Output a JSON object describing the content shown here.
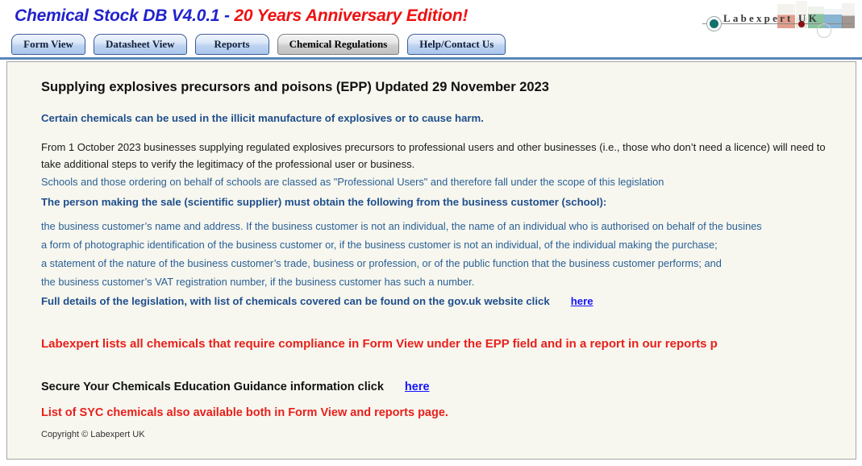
{
  "header": {
    "title_blue": "Chemical Stock DB V4.0.1",
    "title_dash": "  -  ",
    "title_red": "20 Years Anniversary Edition!",
    "logo_text": "Labexpert UK"
  },
  "nav": {
    "tabs": [
      {
        "label": "Form View",
        "active": false
      },
      {
        "label": "Datasheet View",
        "active": false
      },
      {
        "label": "Reports",
        "active": false
      },
      {
        "label": "Chemical Regulations",
        "active": true
      },
      {
        "label": "Help/Contact Us",
        "active": false
      }
    ]
  },
  "content": {
    "section_heading": "Supplying explosives precursors and poisons (EPP) Updated 29 November 2023",
    "lead_statement": "Certain chemicals can be used in the illicit manufacture of explosives or to cause harm.",
    "intro_para": "From 1 October 2023 businesses supplying regulated explosives precursors to professional users and other businesses (i.e., those who don’t need a licence) will need to take additional steps to verify the legitimacy of the professional user or business.",
    "schools_note": "Schools and those ordering on behalf of schools are classed as \"Professional Users\" and therefore fall under the scope of this legislation",
    "obligation_heading": "The person making the sale (scientific supplier) must obtain the following from the business customer (school):",
    "requirements": [
      "the business customer’s name and address. If the business customer is not an individual, the name of an individual who is authorised on behalf of the busines",
      "a form of photographic identification of the business customer or, if the business customer is not an individual, of the individual making the purchase;",
      "a statement of the nature of the business customer’s trade, business or profession, or of the public function that the business customer performs; and",
      "the business customer’s VAT registration number, if the business customer has such a number."
    ],
    "gov_link_text": "Full details of the legislation, with list of chemicals covered can be found on the gov.uk website click",
    "gov_link_label": "here",
    "compliance_note": "Labexpert lists all chemicals that require compliance in Form View under the EPP field and in a report in our reports p",
    "syc_line_text": "Secure Your Chemicals Education Guidance information click",
    "syc_link_label": "here",
    "syc_availability": "List of SYC chemicals also available both in Form View and reports page.",
    "copyright": "Copyright © Labexpert UK"
  },
  "colors": {
    "title_blue": "#2222cc",
    "title_red": "#ee1111",
    "tab_blue": "#a9c6ec",
    "tab_active_grey": "#c0c0c0",
    "divider": "#5a86b8",
    "panel_bg": "#f7f7ef",
    "heading_black": "#111111",
    "body_blue": "#1f4e8c",
    "alert_red": "#e8201c",
    "link_blue": "#1414ff"
  }
}
